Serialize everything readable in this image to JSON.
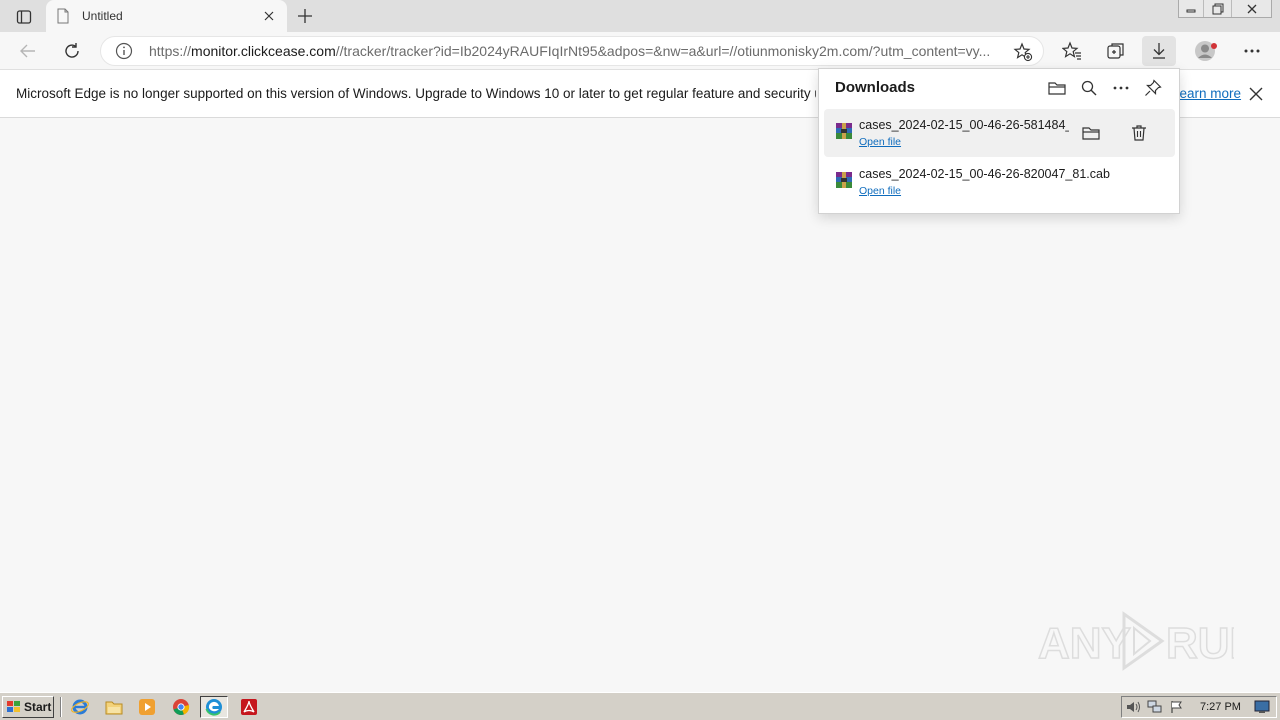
{
  "tab": {
    "title": "Untitled"
  },
  "address": {
    "url_prefix": "https://",
    "url_host": "monitor.clickcease.com",
    "url_rest": "//tracker/tracker?id=Ib2024yRAUFIqIrNt95&adpos=&nw=a&url=//otiunmonisky2m.com/?utm_content=vy..."
  },
  "infobar": {
    "message": "Microsoft Edge is no longer supported on this version of Windows. Upgrade to Windows 10 or later to get regular feature and security updates.",
    "link": "Learn more"
  },
  "downloads": {
    "title": "Downloads",
    "items": [
      {
        "name": "cases_2024-02-15_00-46-26-581484_",
        "action": "Open file"
      },
      {
        "name": "cases_2024-02-15_00-46-26-820047_81.cab",
        "action": "Open file"
      }
    ]
  },
  "taskbar": {
    "start_label": "Start",
    "clock": "7:27 PM"
  },
  "watermark": {
    "text": "ANY RUN"
  },
  "colors": {
    "accent": "#0f6cbd",
    "chrome_bg": "#f7f7f7",
    "tabstrip_bg": "#dfdfdf",
    "taskbar_bg": "#d4d0c8"
  },
  "icons": [
    "tab-actions-icon",
    "page-icon",
    "close-icon",
    "plus-icon",
    "back-icon",
    "refresh-icon",
    "info-icon",
    "add-favorite-icon",
    "favorites-icon",
    "collections-icon",
    "download-icon",
    "profile-icon",
    "more-icon",
    "folder-icon",
    "search-icon",
    "pin-icon",
    "trash-icon",
    "archive-icon",
    "windows-flag-icon",
    "ie-icon",
    "explorer-icon",
    "media-player-icon",
    "chrome-icon",
    "edge-icon",
    "acrobat-icon",
    "volume-icon",
    "network-icon",
    "flag-icon",
    "desktop-icon"
  ]
}
